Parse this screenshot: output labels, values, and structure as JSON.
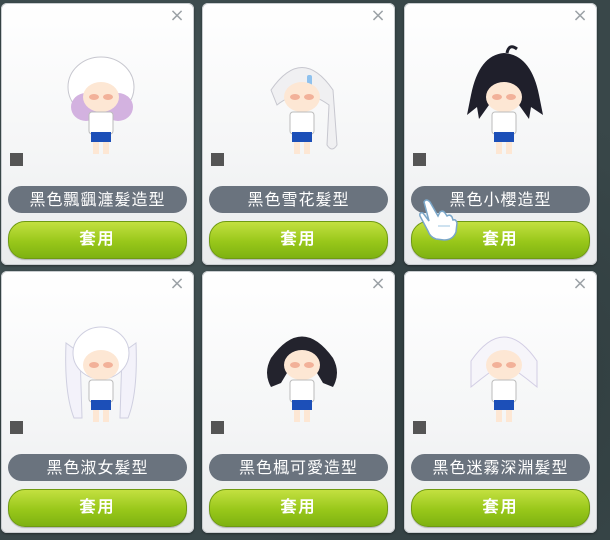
{
  "cards": [
    {
      "name": "黑色飄颻瀍髮造型",
      "apply_label": "套用",
      "close_label": "×",
      "hair_color": "#ffffff",
      "hair_tint": "#c8a2d8"
    },
    {
      "name": "黑色雪花髮型",
      "apply_label": "套用",
      "close_label": "×",
      "hair_color": "#f2f2f4",
      "hair_tint": "#9ec3e6"
    },
    {
      "name": "黑色小櫻造型",
      "apply_label": "套用",
      "close_label": "×",
      "hair_color": "#1e1e2a",
      "hair_tint": "#1e1e2a"
    },
    {
      "name": "黑色淑女髮型",
      "apply_label": "套用",
      "close_label": "×",
      "hair_color": "#ffffff",
      "hair_tint": "#d9d6ef"
    },
    {
      "name": "黑色楓可愛造型",
      "apply_label": "套用",
      "close_label": "×",
      "hair_color": "#22222c",
      "hair_tint": "#22222c"
    },
    {
      "name": "黑色迷霧深淵髮型",
      "apply_label": "套用",
      "close_label": "×",
      "hair_color": "#f4f4f6",
      "hair_tint": "#d8d2ea"
    }
  ],
  "colors": {
    "name_pill": "#6a737e",
    "apply_button": "#98c71a",
    "card_bg": "#f4f5f6"
  },
  "icons": {
    "close": "close-icon",
    "item_marker": "square-marker-icon",
    "cursor": "hand-pointer-icon"
  }
}
